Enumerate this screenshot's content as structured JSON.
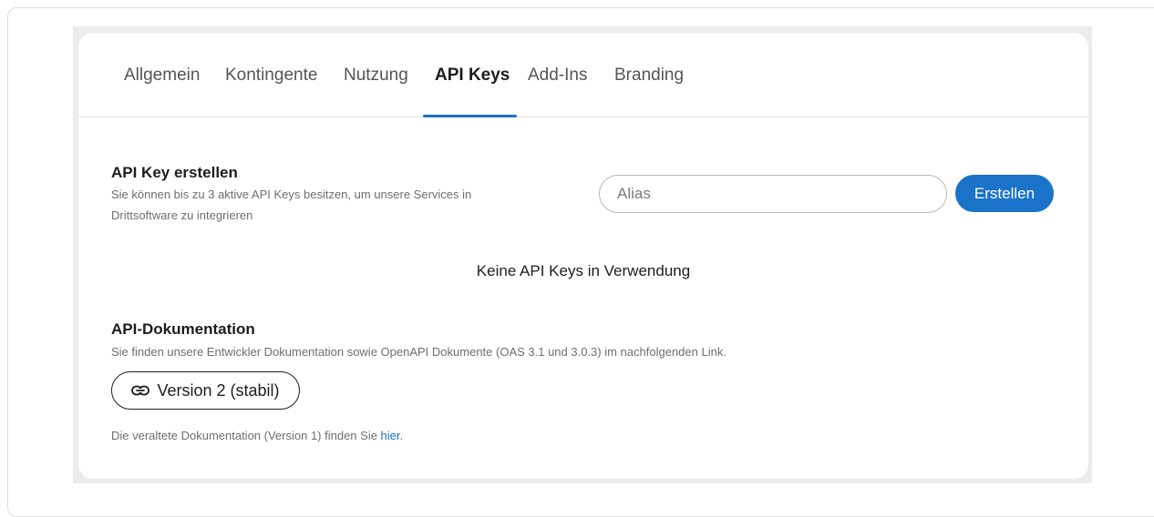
{
  "tabs": [
    {
      "label": "Allgemein"
    },
    {
      "label": "Kontingente"
    },
    {
      "label": "Nutzung"
    },
    {
      "label": "API Keys",
      "active": true
    },
    {
      "label": "Add-Ins"
    },
    {
      "label": "Branding"
    }
  ],
  "create_section": {
    "title": "API Key erstellen",
    "description": "Sie können bis zu 3 aktive API Keys besitzen, um unsere Services in Drittsoftware zu integrieren",
    "alias_placeholder": "Alias",
    "alias_value": "",
    "create_label": "Erstellen"
  },
  "empty_state": "Keine API Keys in Verwendung",
  "docs_section": {
    "title": "API-Dokumentation",
    "description": "Sie finden unsere Entwickler Dokumentation sowie OpenAPI Dokumente (OAS 3.1 und 3.0.3) im nachfolgenden Link.",
    "version_button_label": "Version 2 (stabil)",
    "version_button_icon": "link-icon",
    "old_doc_text": "Die veraltete Dokumentation (Version 1) finden Sie ",
    "old_doc_link": "hier",
    "old_doc_suffix": "."
  },
  "colors": {
    "accent": "#1a73c8",
    "text": "#1d1d1f",
    "muted": "#6e6e73"
  }
}
